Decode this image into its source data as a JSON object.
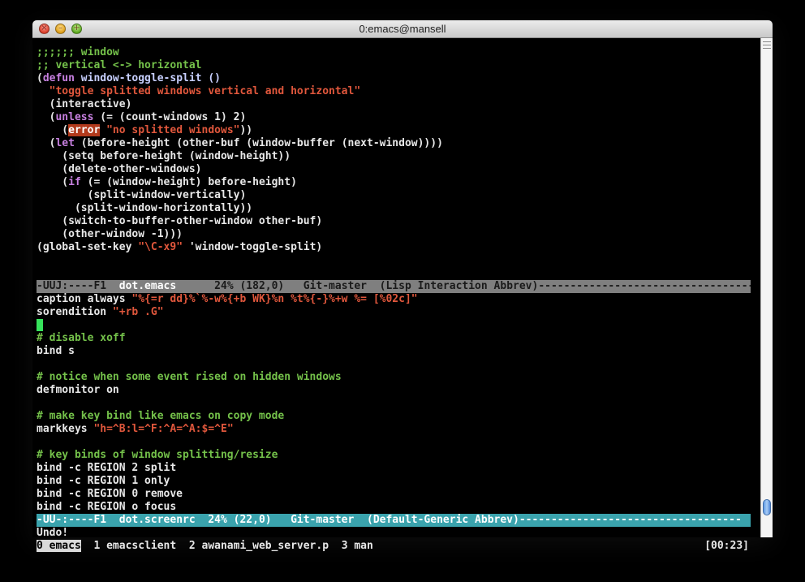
{
  "window": {
    "title": "0:emacs@mansell"
  },
  "editor_top": {
    "lines": [
      [
        {
          "t": ";;;;;; window",
          "c": "cm"
        }
      ],
      [
        {
          "t": ";; vertical <-> horizontal",
          "c": "cm"
        }
      ],
      [
        {
          "t": "(",
          "c": ""
        },
        {
          "t": "defun",
          "c": "kw"
        },
        {
          "t": " window-toggle-split ()",
          "c": "fn"
        }
      ],
      [
        {
          "t": "  \"toggle splitted windows vertical and horizontal\"",
          "c": "str"
        }
      ],
      [
        {
          "t": "  (interactive)",
          "c": ""
        }
      ],
      [
        {
          "t": "  (",
          "c": ""
        },
        {
          "t": "unless",
          "c": "kw"
        },
        {
          "t": " (= (count-windows 1) 2)",
          "c": ""
        }
      ],
      [
        {
          "t": "    (",
          "c": ""
        },
        {
          "t": "error",
          "c": "err"
        },
        {
          "t": " ",
          "c": ""
        },
        {
          "t": "\"no splitted windows\"",
          "c": "str"
        },
        {
          "t": "))",
          "c": ""
        }
      ],
      [
        {
          "t": "  (",
          "c": ""
        },
        {
          "t": "let",
          "c": "kw"
        },
        {
          "t": " (before-height (other-buf (window-buffer (next-window))))",
          "c": ""
        }
      ],
      [
        {
          "t": "    (setq before-height (window-height))",
          "c": ""
        }
      ],
      [
        {
          "t": "    (delete-other-windows)",
          "c": ""
        }
      ],
      [
        {
          "t": "    (",
          "c": ""
        },
        {
          "t": "if",
          "c": "kw"
        },
        {
          "t": " (= (window-height) before-height)",
          "c": ""
        }
      ],
      [
        {
          "t": "        (split-window-vertically)",
          "c": ""
        }
      ],
      [
        {
          "t": "      (split-window-horizontally))",
          "c": ""
        }
      ],
      [
        {
          "t": "    (switch-to-buffer-other-window other-buf)",
          "c": ""
        }
      ],
      [
        {
          "t": "    (other-window -1)))",
          "c": ""
        }
      ],
      [
        {
          "t": "(global-set-key ",
          "c": ""
        },
        {
          "t": "\"\\C-x9\"",
          "c": "str"
        },
        {
          "t": " 'window-toggle-split)",
          "c": ""
        }
      ]
    ]
  },
  "modeline_top": {
    "prefix": "-UUJ:----F1  ",
    "buffer": "dot.emacs",
    "suffix": "      24% (182,0)   Git-master  (Lisp Interaction Abbrev)-----------------------------------"
  },
  "editor_bottom": {
    "lines": [
      [
        {
          "t": "caption always ",
          "c": ""
        },
        {
          "t": "\"%{=r dd}%`%-w%{+b WK}%n %t%{-}%+w %= [%02c]\"",
          "c": "str"
        }
      ],
      [
        {
          "t": "sorendition ",
          "c": ""
        },
        {
          "t": "\"+rb .G\"",
          "c": "str"
        }
      ],
      [
        {
          "t": "",
          "c": "cursor"
        }
      ],
      [
        {
          "t": "# disable xoff",
          "c": "cm"
        }
      ],
      [
        {
          "t": "bind s",
          "c": ""
        }
      ],
      [
        {
          "t": "",
          "c": ""
        }
      ],
      [
        {
          "t": "# notice when some event rised on hidden windows",
          "c": "cm"
        }
      ],
      [
        {
          "t": "defmonitor on",
          "c": ""
        }
      ],
      [
        {
          "t": "",
          "c": ""
        }
      ],
      [
        {
          "t": "# make key bind like emacs on copy mode",
          "c": "cm"
        }
      ],
      [
        {
          "t": "markkeys ",
          "c": ""
        },
        {
          "t": "\"h=^B:l=^F:^A=^A:$=^E\"",
          "c": "str"
        }
      ],
      [
        {
          "t": "",
          "c": ""
        }
      ],
      [
        {
          "t": "# key binds of window splitting/resize",
          "c": "cm"
        }
      ],
      [
        {
          "t": "bind -c REGION 2 split",
          "c": ""
        }
      ],
      [
        {
          "t": "bind -c REGION 1 only",
          "c": ""
        }
      ],
      [
        {
          "t": "bind -c REGION 0 remove",
          "c": ""
        }
      ],
      [
        {
          "t": "bind -c REGION o focus",
          "c": ""
        }
      ]
    ]
  },
  "modeline_bottom": {
    "prefix": "-UU-:----F1  ",
    "buffer": "dot.screenrc",
    "suffix": "  24% (22,0)   Git-master  (Default-Generic Abbrev)-----------------------------------"
  },
  "minibuffer": {
    "text": "Undo!"
  },
  "screen_bar": {
    "active": "0 emacs",
    "rest": "  1 emacsclient  2 awanami_web_server.p  3 man",
    "clock": "[00:23]"
  },
  "colors": {
    "comment": "#74c14a",
    "keyword": "#c780e0",
    "string": "#e0573c",
    "modeline_active": "#3aa3ad",
    "modeline_inactive": "#7f7f7f",
    "cursor": "#36e25b"
  }
}
